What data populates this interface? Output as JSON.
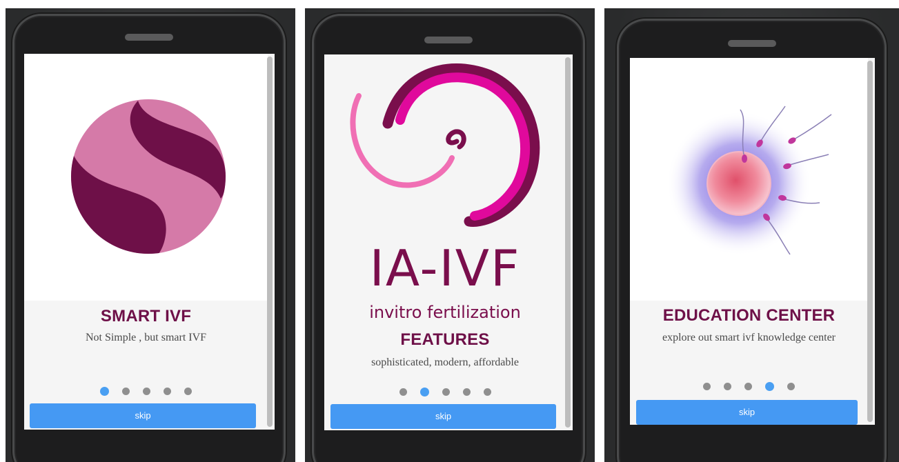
{
  "screens": [
    {
      "title": "SMART IVF",
      "subtitle": "Not Simple , but smart IVF",
      "skip_label": "skip",
      "active_dot": 0,
      "dot_count": 5
    },
    {
      "brand": "IA-IVF",
      "brand_tagline": "invitro fertilization",
      "title": "FEATURES",
      "subtitle": "sophisticated, modern, affordable",
      "skip_label": "skip",
      "active_dot": 1,
      "dot_count": 5
    },
    {
      "title": "EDUCATION CENTER",
      "subtitle": "explore out smart ivf knowledge center",
      "skip_label": "skip",
      "active_dot": 3,
      "dot_count": 5
    }
  ],
  "colors": {
    "title": "#6e1048",
    "skip_button": "#4599f3",
    "active_dot": "#4a9ff2",
    "inactive_dot": "#8f8f8f",
    "logo_pink": "#d57aa8",
    "logo_dark": "#6e1048",
    "brand_magenta": "#e0099c"
  },
  "icons": [
    "s-logo-icon",
    "ia-ivf-logo-icon",
    "egg-sperm-illustration-icon"
  ]
}
